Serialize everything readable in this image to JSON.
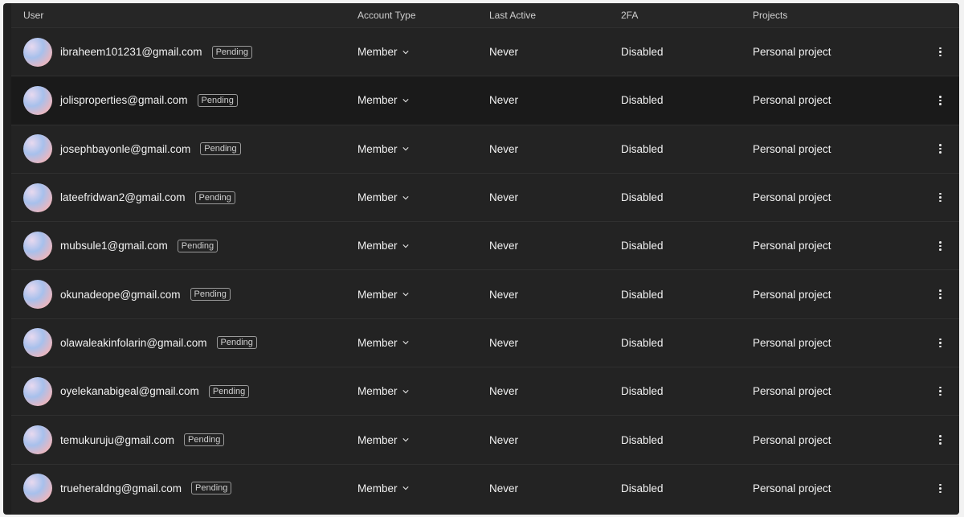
{
  "table": {
    "headers": {
      "user": "User",
      "account_type": "Account Type",
      "last_active": "Last Active",
      "two_fa": "2FA",
      "projects": "Projects"
    },
    "rows": [
      {
        "email": "ibraheem101231@gmail.com",
        "status": "Pending",
        "account_type": "Member",
        "last_active": "Never",
        "two_fa": "Disabled",
        "project": "Personal project"
      },
      {
        "email": "jolisproperties@gmail.com",
        "status": "Pending",
        "account_type": "Member",
        "last_active": "Never",
        "two_fa": "Disabled",
        "project": "Personal project"
      },
      {
        "email": "josephbayonle@gmail.com",
        "status": "Pending",
        "account_type": "Member",
        "last_active": "Never",
        "two_fa": "Disabled",
        "project": "Personal project"
      },
      {
        "email": "lateefridwan2@gmail.com",
        "status": "Pending",
        "account_type": "Member",
        "last_active": "Never",
        "two_fa": "Disabled",
        "project": "Personal project"
      },
      {
        "email": "mubsule1@gmail.com",
        "status": "Pending",
        "account_type": "Member",
        "last_active": "Never",
        "two_fa": "Disabled",
        "project": "Personal project"
      },
      {
        "email": "okunadeope@gmail.com",
        "status": "Pending",
        "account_type": "Member",
        "last_active": "Never",
        "two_fa": "Disabled",
        "project": "Personal project"
      },
      {
        "email": "olawaleakinfolarin@gmail.com",
        "status": "Pending",
        "account_type": "Member",
        "last_active": "Never",
        "two_fa": "Disabled",
        "project": "Personal project"
      },
      {
        "email": "oyelekanabigeal@gmail.com",
        "status": "Pending",
        "account_type": "Member",
        "last_active": "Never",
        "two_fa": "Disabled",
        "project": "Personal project"
      },
      {
        "email": "temukuruju@gmail.com",
        "status": "Pending",
        "account_type": "Member",
        "last_active": "Never",
        "two_fa": "Disabled",
        "project": "Personal project"
      },
      {
        "email": "trueheraldng@gmail.com",
        "status": "Pending",
        "account_type": "Member",
        "last_active": "Never",
        "two_fa": "Disabled",
        "project": "Personal project"
      }
    ]
  },
  "icons": {
    "dropdown": "chevron-down-icon",
    "row_menu": "more-vertical-icon",
    "avatar": "avatar"
  },
  "colors": {
    "background": "#232323",
    "header_bg": "#262626",
    "highlight_row": "#1a1a1a",
    "text": "#f2f2f2",
    "muted": "#cfcfcf"
  }
}
